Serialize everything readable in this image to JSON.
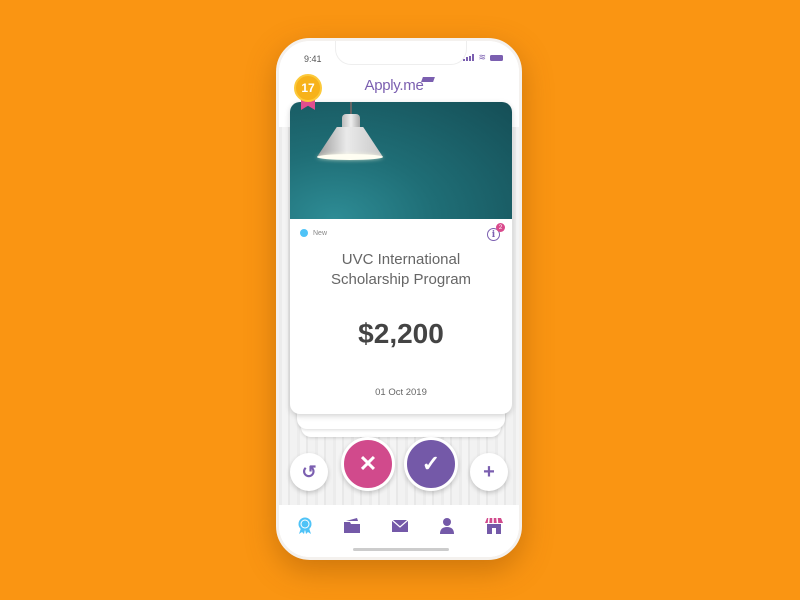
{
  "status_bar": {
    "time": "9:41"
  },
  "header": {
    "logo": "Apply.me",
    "badge_count": "17"
  },
  "card": {
    "tag": "New",
    "info_count": "2",
    "title_line1": "UVC International",
    "title_line2": "Scholarship Program",
    "amount": "$2,200",
    "date": "01 Oct 2019"
  },
  "actions": {
    "undo_icon": "↺",
    "reject_icon": "✕",
    "accept_icon": "✓",
    "add_icon": "+"
  },
  "nav": {
    "items": [
      "awards",
      "folders",
      "messages",
      "profile",
      "store"
    ],
    "active": "awards"
  },
  "colors": {
    "background": "#FA9512",
    "accent_purple": "#7459A8",
    "accent_pink": "#D14A8C",
    "new_dot": "#4FC3F7",
    "badge_gold": "#F7B21A"
  }
}
